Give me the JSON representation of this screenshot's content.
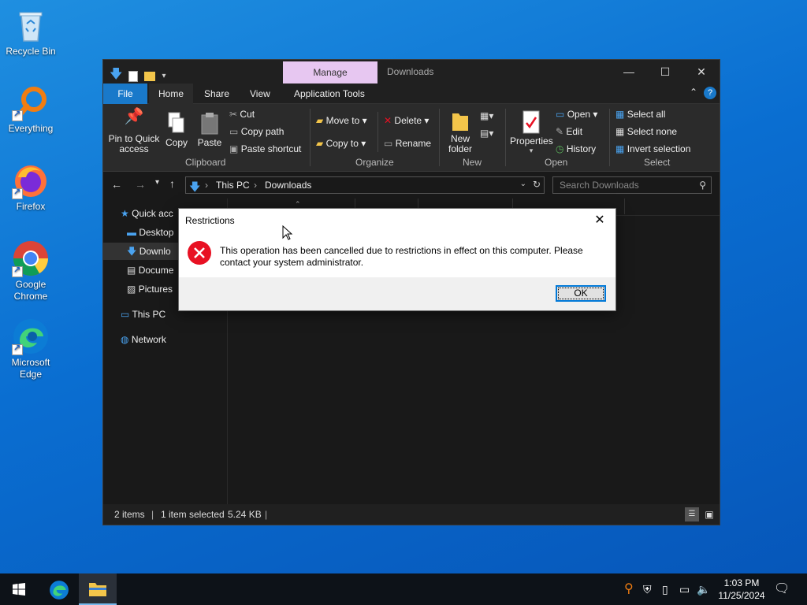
{
  "desktop": {
    "icons": [
      {
        "label": "Recycle Bin"
      },
      {
        "label": "Everything"
      },
      {
        "label": "Firefox"
      },
      {
        "label": "Google Chrome"
      },
      {
        "label": "Microsoft Edge"
      }
    ]
  },
  "explorer": {
    "title": "Downloads",
    "manage_tab": "Manage",
    "tabs": [
      "File",
      "Home",
      "Share",
      "View",
      "Application Tools"
    ],
    "ribbon": {
      "pin_label": "Pin to Quick access",
      "copy_label": "Copy",
      "paste_label": "Paste",
      "cut_label": "Cut",
      "copy_path_label": "Copy path",
      "paste_shortcut_label": "Paste shortcut",
      "clipboard_group": "Clipboard",
      "move_to_label": "Move to",
      "copy_to_label": "Copy to",
      "delete_label": "Delete",
      "rename_label": "Rename",
      "organize_group": "Organize",
      "new_folder_label": "New folder",
      "new_group": "New",
      "properties_label": "Properties",
      "open_label": "Open",
      "edit_label": "Edit",
      "history_label": "History",
      "open_group": "Open",
      "select_all_label": "Select all",
      "select_none_label": "Select none",
      "invert_selection_label": "Invert selection",
      "select_group": "Select"
    },
    "address": {
      "crumbs": [
        "This PC",
        "Downloads"
      ],
      "search_placeholder": "Search Downloads"
    },
    "nav": {
      "items": [
        "Quick acc",
        "Desktop",
        "Downlo",
        "Docume",
        "Pictures",
        "This PC",
        "Network"
      ]
    },
    "status": {
      "items": "2 items",
      "selected": "1 item selected",
      "size": "5.24 KB"
    }
  },
  "dialog": {
    "title": "Restrictions",
    "message": "This operation has been cancelled due to restrictions in effect on this computer. Please contact your system administrator.",
    "ok_label": "OK"
  },
  "taskbar": {
    "time": "1:03 PM",
    "date": "11/25/2024"
  },
  "colors": {
    "accent": "#1979ca",
    "manage_tab": "#e7c7f1",
    "error": "#e81123"
  }
}
